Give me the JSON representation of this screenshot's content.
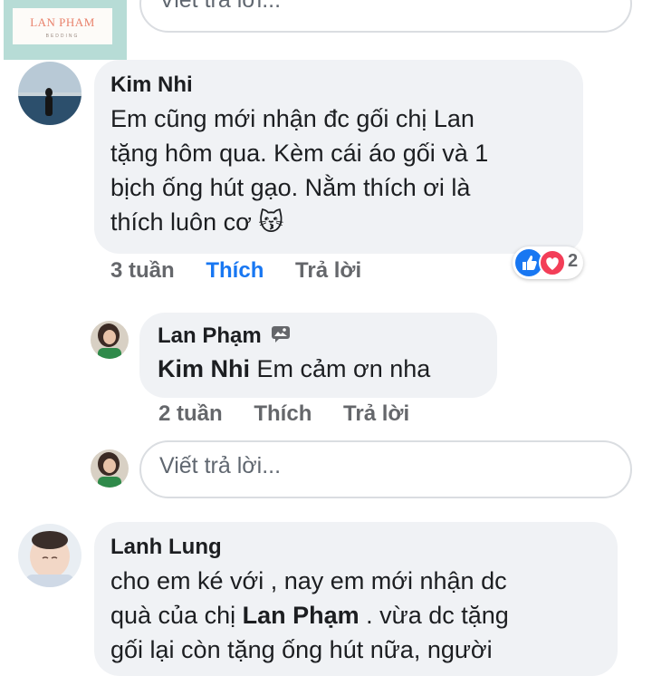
{
  "brand": {
    "name": "LAN PHAM",
    "sub": "BEDDING"
  },
  "top_reply_input": {
    "placeholder": "Viết trả lời..."
  },
  "comments": [
    {
      "author": "Kim Nhi",
      "lines": [
        "Em cũng mới nhận đc gối  chị Lan",
        "tặng hôm qua. Kèm cái áo gối và 1",
        "bịch ống hút gạo. Nằm thích ơi là",
        "thích luôn cơ 😽"
      ],
      "time": "3 tuần",
      "like_label": "Thích",
      "reply_label": "Trả lời",
      "reaction_count": "2",
      "reactions": [
        "like-icon",
        "heart-icon"
      ]
    },
    {
      "author": "Lan Phạm",
      "author_badge": "speech-photo-icon",
      "mention": "Kim Nhi",
      "text": "Em cảm ơn nha",
      "time": "2 tuần",
      "like_label": "Thích",
      "reply_label": "Trả lời"
    },
    {
      "author": "Lanh Lung",
      "line1": "cho em ké với , nay em mới nhận dc",
      "line2_pre": "quà của chị ",
      "line2_bold": "Lan Phạm",
      "line2_post": " . vừa dc tặng",
      "line3": "gối lại còn tặng ống hút nữa, người"
    }
  ],
  "reply_input": {
    "placeholder": "Viết trả lời..."
  },
  "colors": {
    "bubble": "#f0f2f5",
    "like_blue": "#1877f2",
    "meta_gray": "#65676b",
    "heart_red": "#f33e58"
  }
}
